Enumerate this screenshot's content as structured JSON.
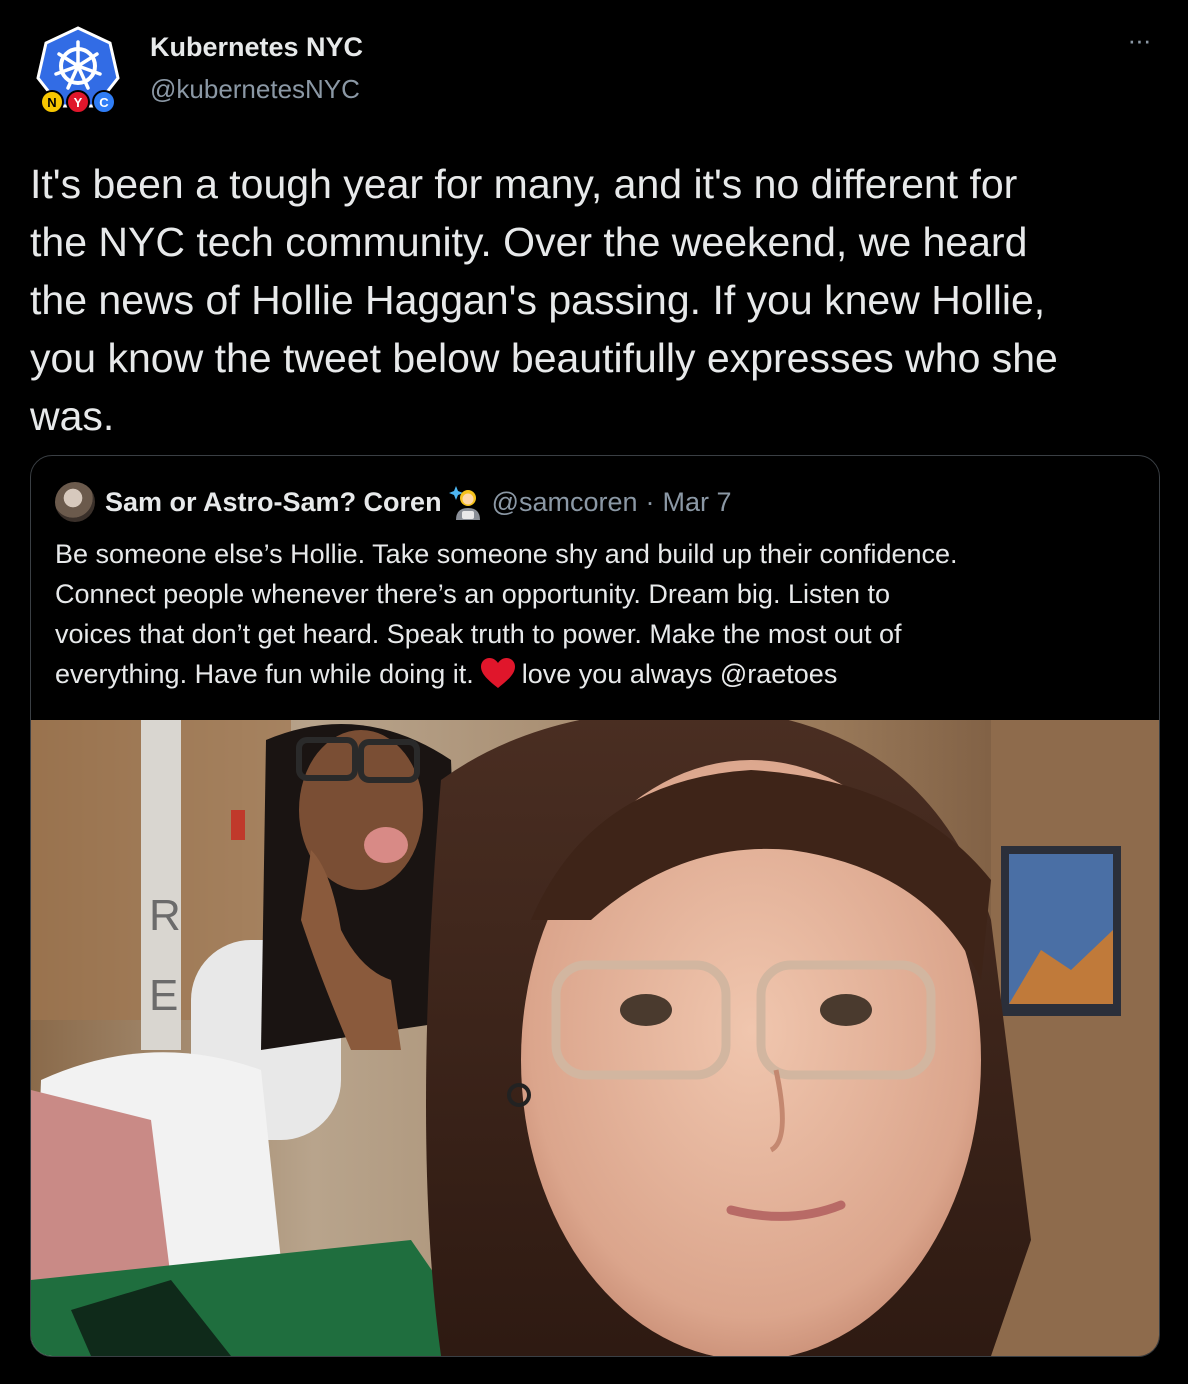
{
  "author": {
    "name": "Kubernetes NYC",
    "handle": "@kubernetesNYC",
    "avatar_icon": "kubernetes-nyc-logo-icon",
    "avatar_badge_letters": [
      "N",
      "Y",
      "C"
    ]
  },
  "more_icon": "more-options-icon",
  "more_label": "···",
  "tweet_text": "It's been a tough year for many, and it's no different for\nthe NYC tech community. Over the weekend, we heard\nthe news of Hollie Haggan's passing. If you knew Hollie,\nyou know the tweet below beautifully expresses who she\nwas.",
  "quoted": {
    "name": "Sam or Astro-Sam? Coren",
    "name_emoji_icon": "woman-astronaut-emoji-icon",
    "handle": "@samcoren",
    "separator": "·",
    "date": "Mar 7",
    "text_lines": [
      "Be someone else’s Hollie. Take someone shy and build up their confidence.",
      "Connect people whenever there’s an opportunity. Dream big. Listen to",
      "voices that don’t get heard. Speak truth to power. Make the most out of"
    ],
    "last_line_before": "everything. Have fun while doing it.",
    "heart_icon": "red-heart-emoji-icon",
    "last_line_after": "love you always @raetoes",
    "photo_icon": "selfie-photo"
  },
  "colors": {
    "background": "#000000",
    "text": "#e7e9ea",
    "secondary_text": "#8b98a5",
    "kubernetes_blue": "#326ce5",
    "heart_red": "#e0162b"
  }
}
